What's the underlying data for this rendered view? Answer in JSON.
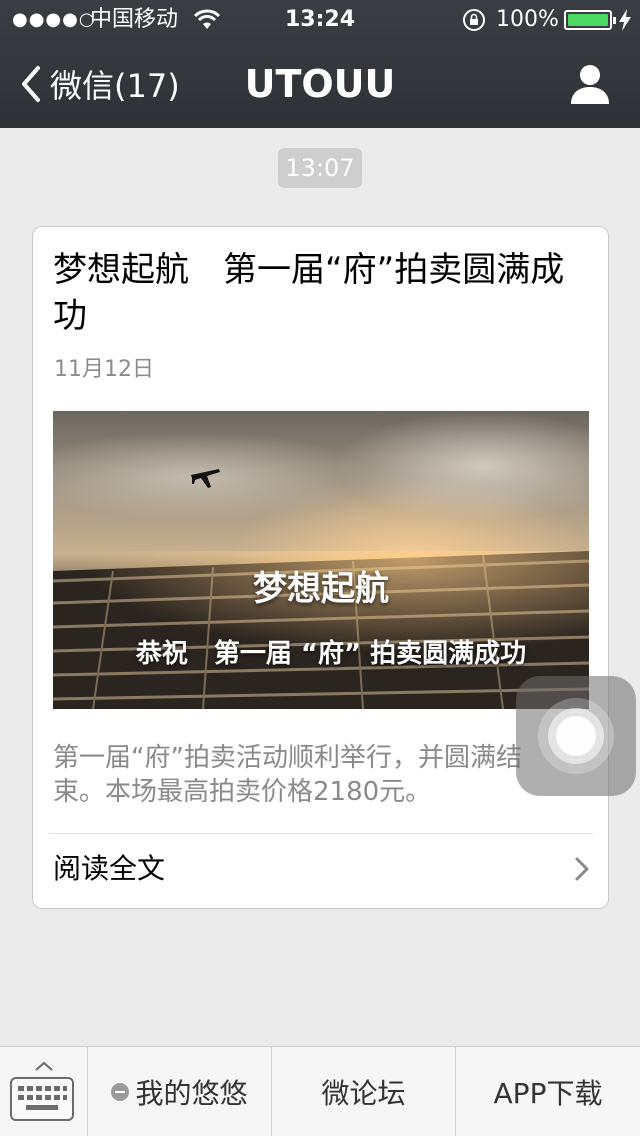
{
  "status_bar": {
    "signal": "●●●●○",
    "carrier": "中国移动",
    "time": "13:24",
    "battery_percent": "100%",
    "battery_color": "#4cd964"
  },
  "nav": {
    "back_label": "微信(17)",
    "title": "UTOUU",
    "profile_icon": "person-icon"
  },
  "timestamp": "13:07",
  "article": {
    "headline": "梦想起航　第一届“府”拍卖圆满成功",
    "date": "11月12日",
    "cover_title": "梦想起航",
    "cover_subtitle": "恭祝　第一届 “府” 拍卖圆满成功",
    "summary": "第一届“府”拍卖活动顺利举行，并圆满结束。本场最高拍卖价格2180元。",
    "read_more": "阅读全文"
  },
  "bottom_menu": {
    "keyboard_icon": "keyboard-icon",
    "items": [
      {
        "label": "我的悠悠"
      },
      {
        "label": "微论坛"
      },
      {
        "label": "APP下载"
      }
    ]
  }
}
